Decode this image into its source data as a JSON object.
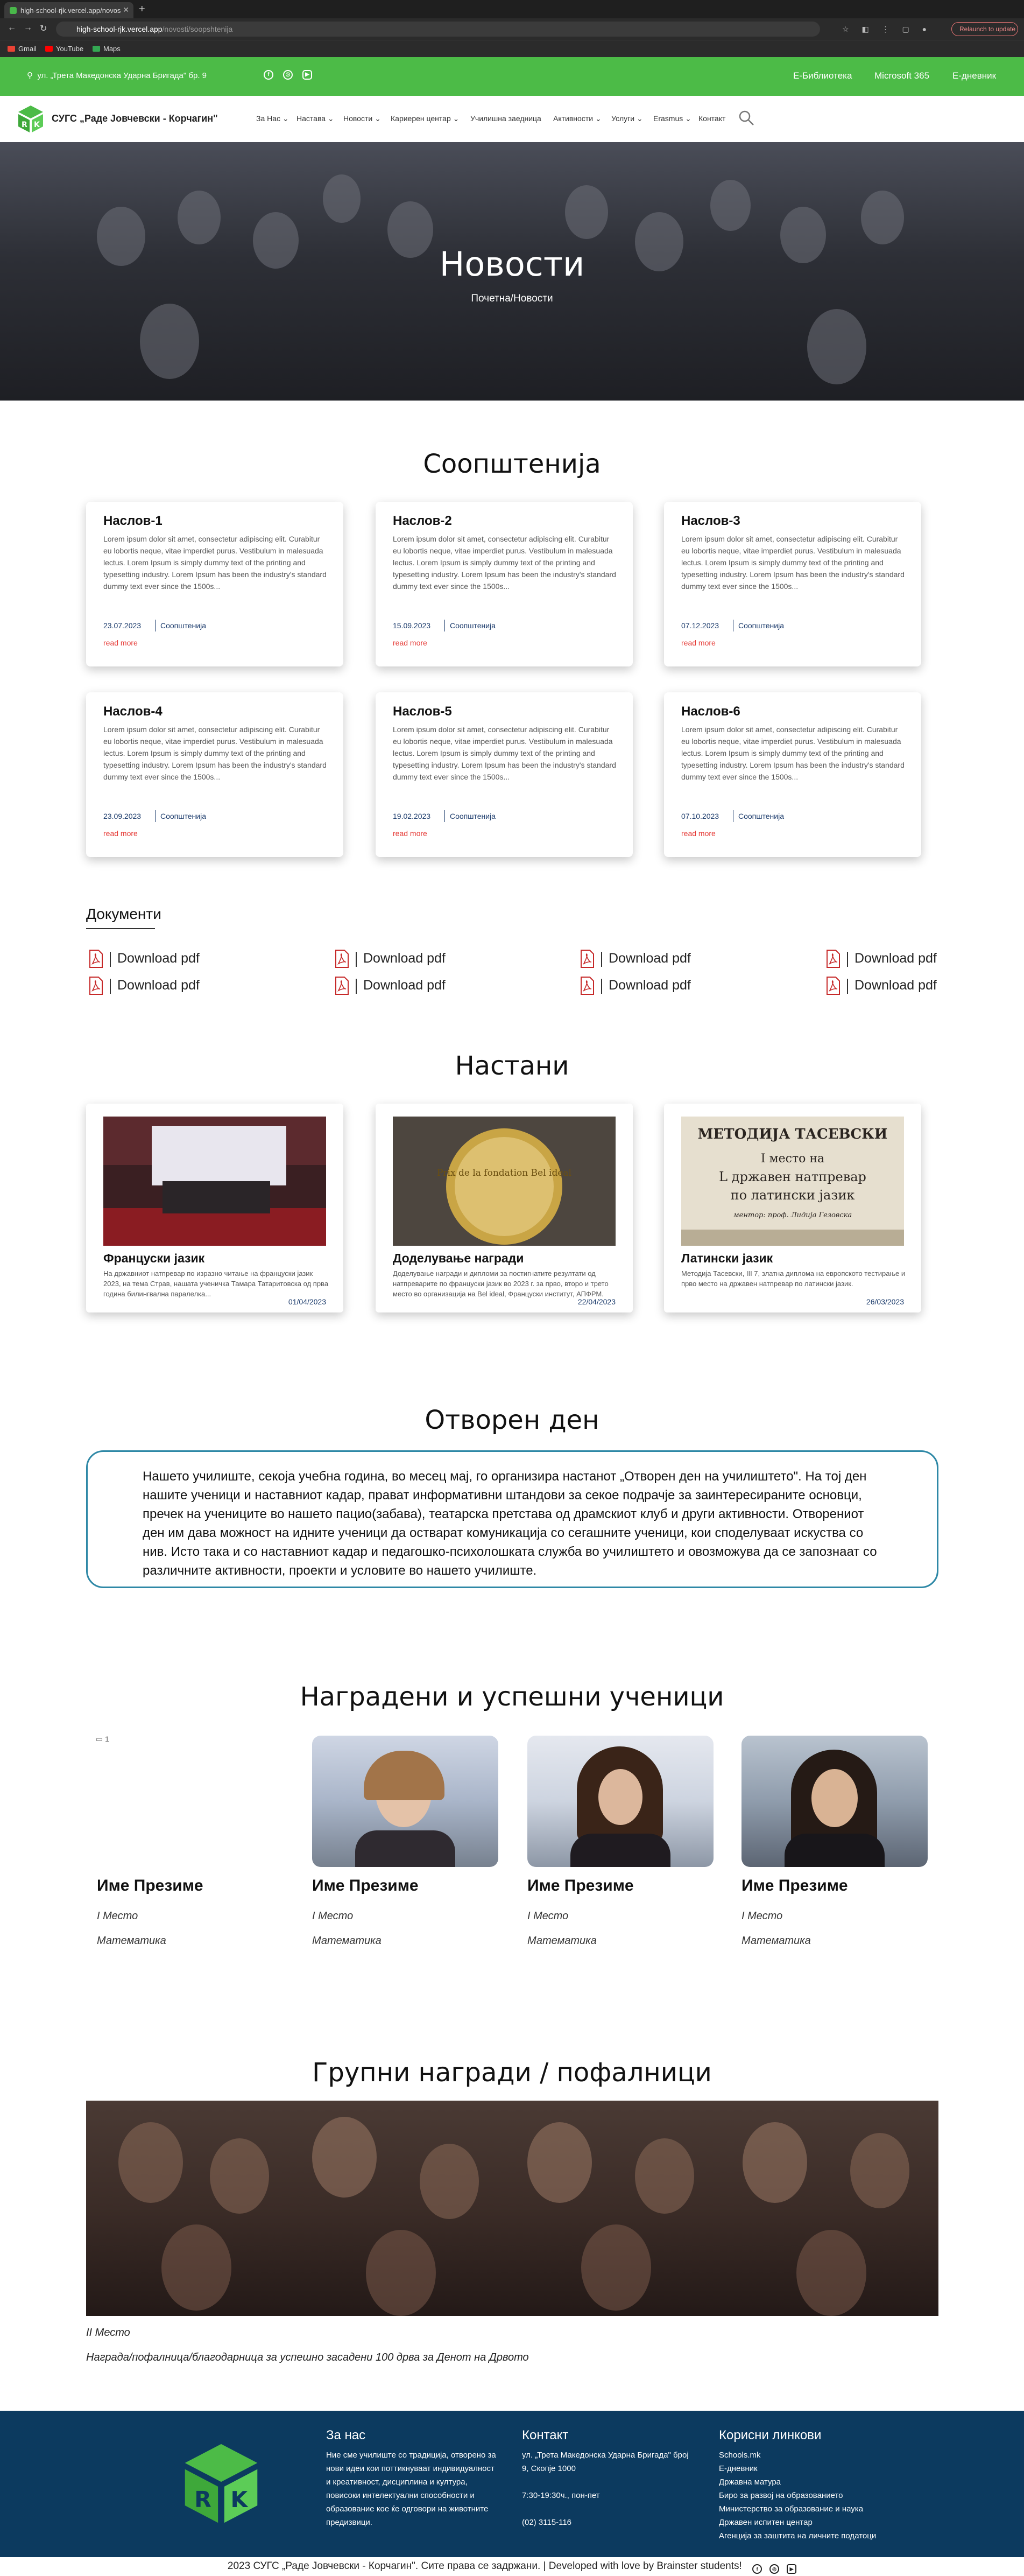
{
  "browser": {
    "tab_title": "high-school-rjk.vercel.app/novos",
    "url_host": "high-school-rjk.vercel.app",
    "url_path": "/novosti/soopshtenija",
    "relaunch_label": "Relaunch to update",
    "bookmarks": [
      "Gmail",
      "YouTube",
      "Maps"
    ]
  },
  "topbar": {
    "address": "ул. „Трета Македонска Ударна Бригада\" бр. 9",
    "links": [
      "Е-Библиотека",
      "Microsoft 365",
      "Е-дневник"
    ]
  },
  "nav": {
    "school_name": "СУГС „Раде Јовчевски - Корчагин\"",
    "items": [
      "За Нас",
      "Настава",
      "Новости",
      "Кариерен центар",
      "Училишна заедница",
      "Активности",
      "Услуги",
      "Erasmus",
      "Контакт"
    ]
  },
  "hero": {
    "title": "Новости",
    "breadcrumb": "Почетна/Новости"
  },
  "announcements": {
    "title": "Соопштенија",
    "lorem": "Lorem ipsum dolor sit amet, consectetur adipiscing elit. Curabitur eu lobortis neque, vitae imperdiet purus. Vestibulum in malesuada lectus. Lorem Ipsum is simply dummy text of the printing and typesetting industry. Lorem Ipsum has been the industry's standard dummy text ever since the 1500s...",
    "category": "Соопштенија",
    "read_more": "read more",
    "items": [
      {
        "title": "Наслов-1",
        "date": "23.07.2023"
      },
      {
        "title": "Наслов-2",
        "date": "15.09.2023"
      },
      {
        "title": "Наслов-3",
        "date": "07.12.2023"
      },
      {
        "title": "Наслов-4",
        "date": "23.09.2023"
      },
      {
        "title": "Наслов-5",
        "date": "19.02.2023"
      },
      {
        "title": "Наслов-6",
        "date": "07.10.2023"
      }
    ]
  },
  "documents": {
    "title": "Документи",
    "label": "Download pdf"
  },
  "events": {
    "title": "Настани",
    "items": [
      {
        "title": "Француски јазик",
        "body": "На државниот натпревар по изразно читање на француски јазик 2023, на тема Страв, нашата ученичка Тамара Татаритовска од прва година билингвална паралелка...",
        "date": "01/04/2023"
      },
      {
        "title": "Доделување награди",
        "body": "Доделување награди и дипломи за постигнатите резултати од натпреварите по француски јазик во 2023 г. за прво, второ и трето место во организација на Bel ideal, Француски институт, АПФРМ.",
        "date": "22/04/2023"
      },
      {
        "title": "Латински јазик",
        "body": "Методија Тасевски, III 7, златна диплома на европското тестирање и прво место на државен натпревар по латински јазик.",
        "date": "26/03/2023"
      }
    ],
    "plaque": {
      "name": "МЕТОДИЈА ТАСЕВСКИ",
      "line1": "I место на",
      "line2": "L државен натпревар",
      "line3": "по латински јазик",
      "mentor": "ментор: проф. Лидија Гезовска"
    },
    "medal_text": "Prix de la fondation Bel ideal"
  },
  "open_day": {
    "title": "Отворен ден",
    "text": "Нашето училиште, секоја учебна година, во месец мај, го организира настанот „Отворен ден на училиштето\". На тој ден нашите ученици и наставниот кадар, прават информативни штандови за секое подрачје за заинтересираните основци, пречек на учениците во нашето пацио(забава), театарска претстава од драмскиот клуб и други активности. Отворениот ден им дава можност на идните ученици да остварат комуникација со сегашните ученици, кои споделуваат искуства со нив. Исто така и со наставниот кадар и педагошко-психолошката служба во училиштето и овозможува да се запознаат со различните активности, проекти и условите во нашето училиште."
  },
  "students": {
    "title": "Наградени и успешни ученици",
    "broken_img_alt": "1",
    "items": [
      {
        "name": "Име Презиме",
        "place": "I Место",
        "subject": "Математика"
      },
      {
        "name": "Име Презиме",
        "place": "I Место",
        "subject": "Математика"
      },
      {
        "name": "Име Презиме",
        "place": "I Место",
        "subject": "Математика"
      },
      {
        "name": "Име Презиме",
        "place": "I Место",
        "subject": "Математика"
      }
    ]
  },
  "group": {
    "title": "Групни награди / пофалници",
    "place": "II Место",
    "description": "Награда/пофалница/благодарница за успешно засадени 100 дрва за Денот на Дрвото"
  },
  "footer": {
    "about": {
      "heading": "За нас",
      "lines": [
        "Ние сме училиште со традиција, отворено за",
        "нови идеи кои поттикнуваат индивидуалност",
        "и креативност, дисциплина и култура,",
        "повисоки интелектуални способности и",
        "образование кое ќе одговори на животните",
        "предизвици."
      ]
    },
    "contact": {
      "heading": "Контакт",
      "lines": [
        "ул. „Трета Македонска Ударна Бригада\" број",
        "9, Скопје 1000",
        "",
        "7:30-19:30ч., пон-пет",
        "",
        "(02) 3115-116"
      ]
    },
    "links": {
      "heading": "Корисни линкови",
      "lines": [
        "Schools.mk",
        "Е-дневник",
        "Државна матура",
        "Биро за развој на образованието",
        "Министерство за образование и наука",
        "Државен испитен центар",
        "Агенција за заштита на личните податоци"
      ]
    },
    "copyright": "2023 СУГС „Раде Јовчевски - Корчагин\". Сите права се задржани. | Developed with love by Brainster students!"
  },
  "colors": {
    "green": "#4cbb47",
    "navy": "#0c3a5f",
    "teal_border": "#2e88a6",
    "link_blue": "#1a3a6b",
    "read_more": "#e53935",
    "pdf_red": "#c62828"
  }
}
